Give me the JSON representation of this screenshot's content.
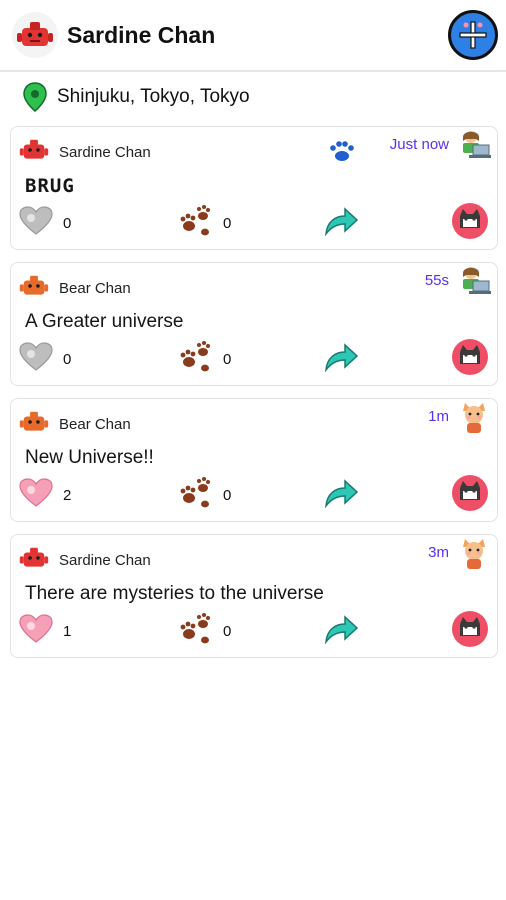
{
  "header": {
    "title": "Sardine Chan"
  },
  "location": {
    "text": "Shinjuku, Tokyo, Tokyo"
  },
  "posts": [
    {
      "author": "Sardine Chan",
      "time": "Just now",
      "content": "BRUG",
      "likes": "0",
      "paws": "0",
      "liked": false,
      "has_paw_icon": true,
      "corner": "laptop"
    },
    {
      "author": "Bear Chan",
      "time": "55s",
      "content": "A Greater universe",
      "likes": "0",
      "paws": "0",
      "liked": false,
      "has_paw_icon": false,
      "corner": "laptop"
    },
    {
      "author": "Bear Chan",
      "time": "1m",
      "content": "New Universe!!",
      "likes": "2",
      "paws": "0",
      "liked": true,
      "has_paw_icon": false,
      "corner": "cat"
    },
    {
      "author": "Sardine Chan",
      "time": "3m",
      "content": "There are mysteries to the universe",
      "likes": "1",
      "paws": "0",
      "liked": true,
      "has_paw_icon": false,
      "corner": "cat"
    }
  ],
  "colors": {
    "accent": "#2f80e4",
    "time": "#5b2ff0",
    "share": "#2ec7b6",
    "paw": "#8a3b1c"
  }
}
